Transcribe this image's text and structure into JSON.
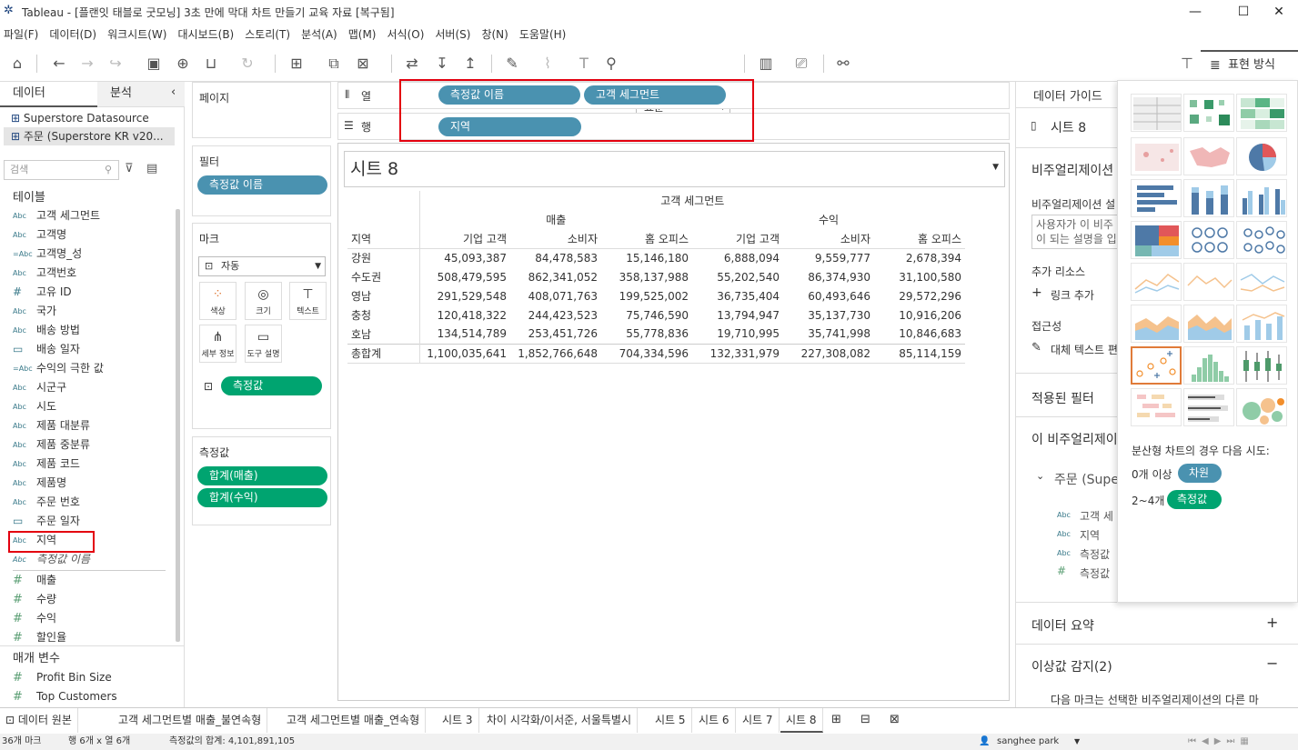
{
  "window": {
    "title": "Tableau - [플랜잇 태블로 굿모닝] 3초 만에 막대 차트 만들기 교육 자료 [복구됨]",
    "minimize": "—",
    "maximize": "☐",
    "close": "✕"
  },
  "menu": [
    "파일(F)",
    "데이터(D)",
    "워크시트(W)",
    "대시보드(B)",
    "스토리(T)",
    "분석(A)",
    "맵(M)",
    "서식(O)",
    "서버(S)",
    "창(N)",
    "도움말(H)"
  ],
  "toolbar": {
    "fit_select": "표준",
    "showme_label": "표현 방식"
  },
  "data_pane": {
    "tab_data": "데이터",
    "tab_analysis": "분석",
    "sources": [
      "Superstore Datasource",
      "주문 (Superstore KR v20..."
    ],
    "search_placeholder": "검색",
    "tables_header": "테이블",
    "fields": [
      {
        "type": "Abc",
        "name": "고객 세그먼트"
      },
      {
        "type": "Abc",
        "name": "고객명"
      },
      {
        "type": "=Abc",
        "name": "고객명_성"
      },
      {
        "type": "Abc",
        "name": "고객번호"
      },
      {
        "type": "#",
        "name": "고유 ID"
      },
      {
        "type": "Abc",
        "name": "국가"
      },
      {
        "type": "Abc",
        "name": "배송 방법"
      },
      {
        "type": "date",
        "name": "배송 일자"
      },
      {
        "type": "=Abc",
        "name": "수익의 극한 값"
      },
      {
        "type": "Abc",
        "name": "시군구"
      },
      {
        "type": "Abc",
        "name": "시도"
      },
      {
        "type": "Abc",
        "name": "제품 대분류"
      },
      {
        "type": "Abc",
        "name": "제품 중분류"
      },
      {
        "type": "Abc",
        "name": "제품 코드"
      },
      {
        "type": "Abc",
        "name": "제품명"
      },
      {
        "type": "Abc",
        "name": "주문 번호"
      },
      {
        "type": "date",
        "name": "주문 일자"
      },
      {
        "type": "Abc",
        "name": "지역"
      },
      {
        "type": "Abc",
        "name": "측정값 이름"
      }
    ],
    "measures": [
      "매출",
      "수량",
      "수익",
      "할인율"
    ],
    "params_header": "매개 변수",
    "params": [
      "Profit Bin Size",
      "Top Customers"
    ]
  },
  "cards": {
    "pages": "페이지",
    "filters": "필터",
    "filter_pill": "측정값 이름",
    "marks": "마크",
    "mark_type": "자동",
    "mark_buttons": [
      "색상",
      "크기",
      "텍스트",
      "세부 정보",
      "도구 설명"
    ],
    "marks_pill": "측정값",
    "measure_values": "측정값",
    "mv_pills": [
      "합계(매출)",
      "합계(수익)"
    ]
  },
  "shelves": {
    "columns_label": "열",
    "rows_label": "행",
    "columns_pills": [
      "측정값 이름",
      "고객 세그먼트"
    ],
    "rows_pills": [
      "지역"
    ]
  },
  "view": {
    "sheet_title": "시트 8",
    "col_group_header": "고객 세그먼트",
    "measures": [
      "매출",
      "수익"
    ],
    "row_header": "지역",
    "segments": [
      "기업 고객",
      "소비자",
      "홈 오피스",
      "기업 고객",
      "소비자",
      "홈 오피스"
    ],
    "rows": [
      {
        "region": "강원",
        "values": [
          "45,093,387",
          "84,478,583",
          "15,146,180",
          "6,888,094",
          "9,559,777",
          "2,678,394"
        ]
      },
      {
        "region": "수도권",
        "values": [
          "508,479,595",
          "862,341,052",
          "358,137,988",
          "55,202,540",
          "86,374,930",
          "31,100,580"
        ]
      },
      {
        "region": "영남",
        "values": [
          "291,529,548",
          "408,071,763",
          "199,525,002",
          "36,735,404",
          "60,493,646",
          "29,572,296"
        ]
      },
      {
        "region": "충청",
        "values": [
          "120,418,322",
          "244,423,523",
          "75,746,590",
          "13,794,947",
          "35,137,730",
          "10,916,206"
        ]
      },
      {
        "region": "호남",
        "values": [
          "134,514,789",
          "253,451,726",
          "55,778,836",
          "19,710,995",
          "35,741,998",
          "10,846,683"
        ]
      }
    ],
    "total": {
      "region": "총합계",
      "values": [
        "1,100,035,641",
        "1,852,766,648",
        "704,334,596",
        "132,331,979",
        "227,308,082",
        "85,114,159"
      ]
    }
  },
  "guide": {
    "tab": "데이터 가이드",
    "sheet": "시트 8",
    "viz_desc_header": "비주얼리제이션 설",
    "viz_desc_label": "비주얼리제이션 설",
    "viz_desc_placeholder": "사용자가 이 비주\n이 되는 설명을 입",
    "resources": "추가 리소스",
    "add_link": "링크 추가",
    "accessibility": "접근성",
    "alt_text": "대체 텍스트 편",
    "applied_filters": "적용된 필터",
    "this_viz": "이 비주얼리제이",
    "tree_root": "주문 (Supe",
    "tree_items": [
      {
        "type": "Abc",
        "name": "고객 세"
      },
      {
        "type": "Abc",
        "name": "지역"
      },
      {
        "type": "Abc",
        "name": "측정값 "
      },
      {
        "type": "#",
        "name": "측정값"
      }
    ],
    "data_summary": "데이터 요약",
    "outliers": "이상값 감지(2)",
    "outlier_desc": "다음 마크는 선택한 비주얼리제이션의 다른 마"
  },
  "showme": {
    "hint_title": "분산형 차트의 경우 다음 시도:",
    "line1_prefix": "0개 이상",
    "line1_pill": "차원",
    "line2_prefix": "2~4개",
    "line2_pill": "측정값"
  },
  "sheets_tabs": [
    "데이터 원본",
    "고객 세그먼트별 매출_불연속형",
    "고객 세그먼트별 매출_연속형",
    "시트 3",
    "차이 시각화/이서준, 서울특별시",
    "시트 5",
    "시트 6",
    "시트 7",
    "시트 8"
  ],
  "status": {
    "marks": "36개 마크",
    "dims": "행 6개 x 열 6개",
    "sum": "측정값의 합계: 4,101,891,105",
    "user": "sanghee park"
  },
  "colors": {
    "pill_blue": "#4a92b0",
    "pill_green": "#00a470",
    "highlight": "#e3000f"
  }
}
